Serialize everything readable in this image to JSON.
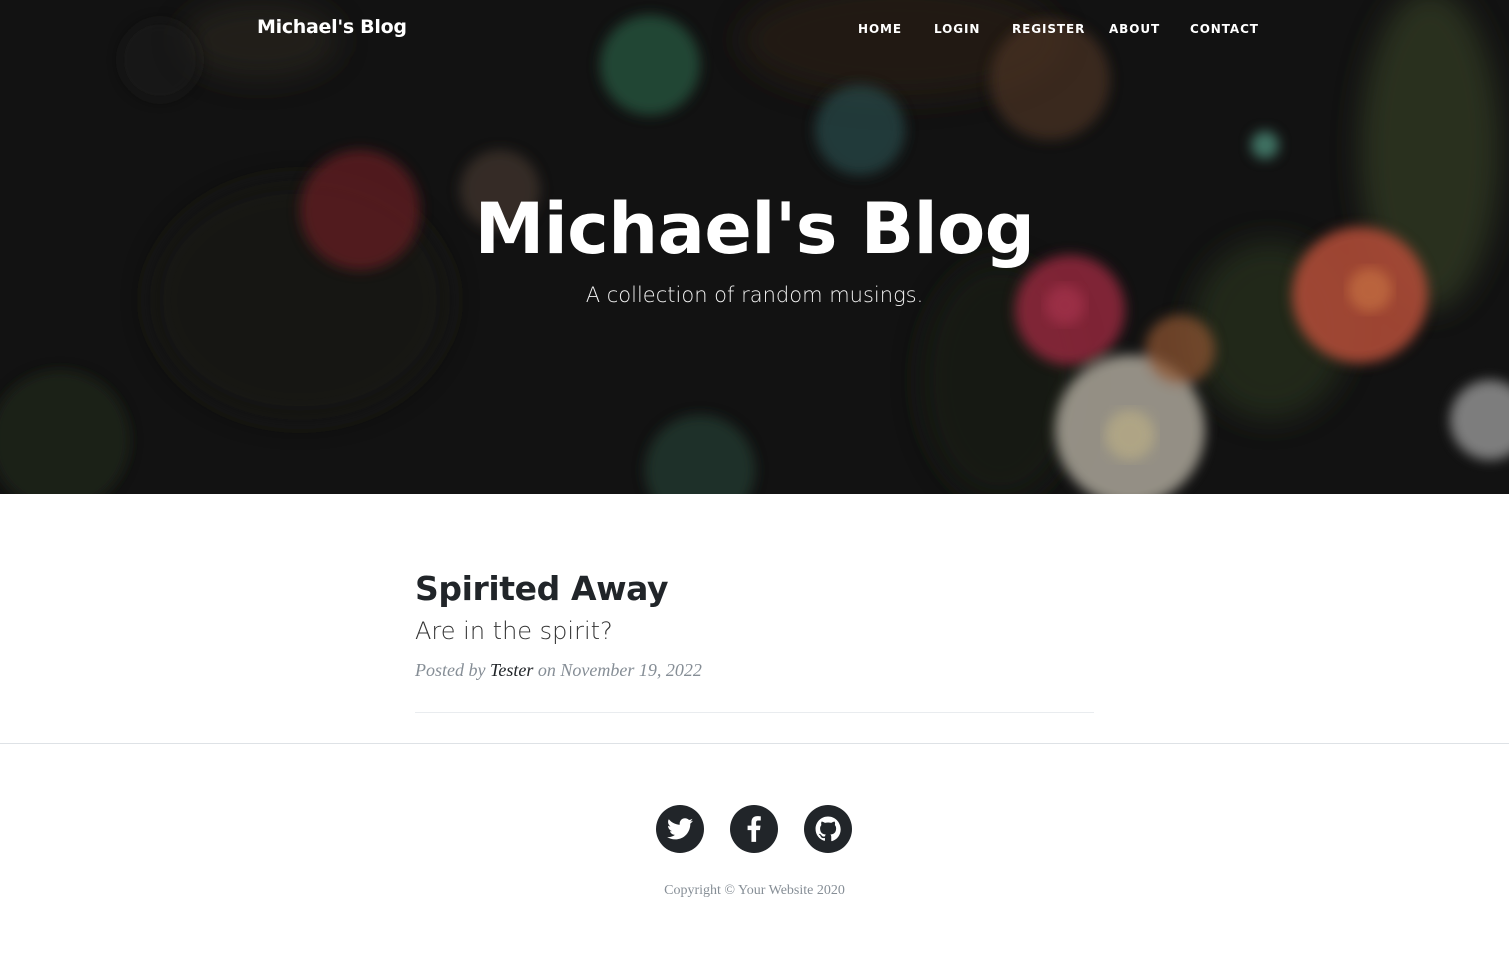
{
  "nav": {
    "brand": "Michael's Blog",
    "items": [
      {
        "label": "HOME"
      },
      {
        "label": "LOGIN"
      },
      {
        "label": "REGISTER"
      },
      {
        "label": "ABOUT"
      },
      {
        "label": "CONTACT"
      }
    ]
  },
  "hero": {
    "title": "Michael's Blog",
    "subtitle": "A collection of random musings."
  },
  "posts": [
    {
      "title": "Spirited Away",
      "subtitle": "Are in the spirit?",
      "meta_prefix": "Posted by ",
      "author": "Tester",
      "meta_suffix": " on November 19, 2022"
    }
  ],
  "footer": {
    "social": [
      {
        "icon": "twitter-icon"
      },
      {
        "icon": "facebook-icon"
      },
      {
        "icon": "github-icon"
      }
    ],
    "copyright": "Copyright © Your Website 2020"
  },
  "colors": {
    "text_dark": "#212529",
    "text_muted": "#868e96",
    "social_bg": "#212529"
  }
}
